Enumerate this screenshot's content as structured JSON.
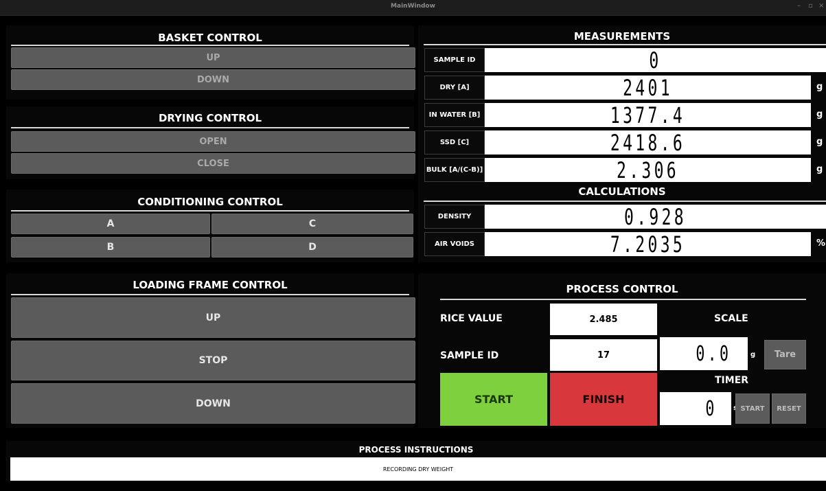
{
  "window": {
    "title": "MainWindow",
    "controls": [
      "–",
      "▫",
      "×"
    ]
  },
  "basket": {
    "title": "BASKET CONTROL",
    "up": "UP",
    "down": "DOWN"
  },
  "drying": {
    "title": "DRYING CONTROL",
    "open": "OPEN",
    "close": "CLOSE"
  },
  "conditioning": {
    "title": "CONDITIONING CONTROL",
    "a": "A",
    "b": "B",
    "c": "C",
    "d": "D"
  },
  "loading": {
    "title": "LOADING FRAME CONTROL",
    "up": "UP",
    "stop": "STOP",
    "down": "DOWN"
  },
  "measurements": {
    "title": "MEASUREMENTS",
    "rows": [
      {
        "label": "SAMPLE ID",
        "value": "0",
        "unit": ""
      },
      {
        "label": "DRY  [A]",
        "value": "2401",
        "unit": "g"
      },
      {
        "label": "IN WATER [B]",
        "value": "1377.4",
        "unit": "g"
      },
      {
        "label": "SSD [C]",
        "value": "2418.6",
        "unit": "g"
      },
      {
        "label": "BULK [A/(C-B)]",
        "value": "2.306",
        "unit": "g"
      }
    ]
  },
  "calculations": {
    "title": "CALCULATIONS",
    "rows": [
      {
        "label": "DENSITY",
        "value": "0.928",
        "unit": ""
      },
      {
        "label": "AIR VOIDS",
        "value": "7.2035",
        "unit": "%"
      }
    ]
  },
  "process": {
    "title": "PROCESS CONTROL",
    "rice_label": "RICE VALUE",
    "rice_value": "2.485",
    "sample_label": "SAMPLE ID",
    "sample_value": "17",
    "scale_label": "SCALE",
    "scale_value": "0.0",
    "scale_unit": "g",
    "tare": "Tare",
    "timer_label": "TIMER",
    "timer_value": "0",
    "timer_unit": "s",
    "timer_start": "START",
    "timer_reset": "RESET",
    "start": "START",
    "finish": "FINISH",
    "colors": {
      "start": "#7ed03f",
      "finish": "#d8383c"
    }
  },
  "instructions": {
    "title": "PROCESS INSTRUCTIONS",
    "text": "RECORDING DRY WEIGHT"
  }
}
